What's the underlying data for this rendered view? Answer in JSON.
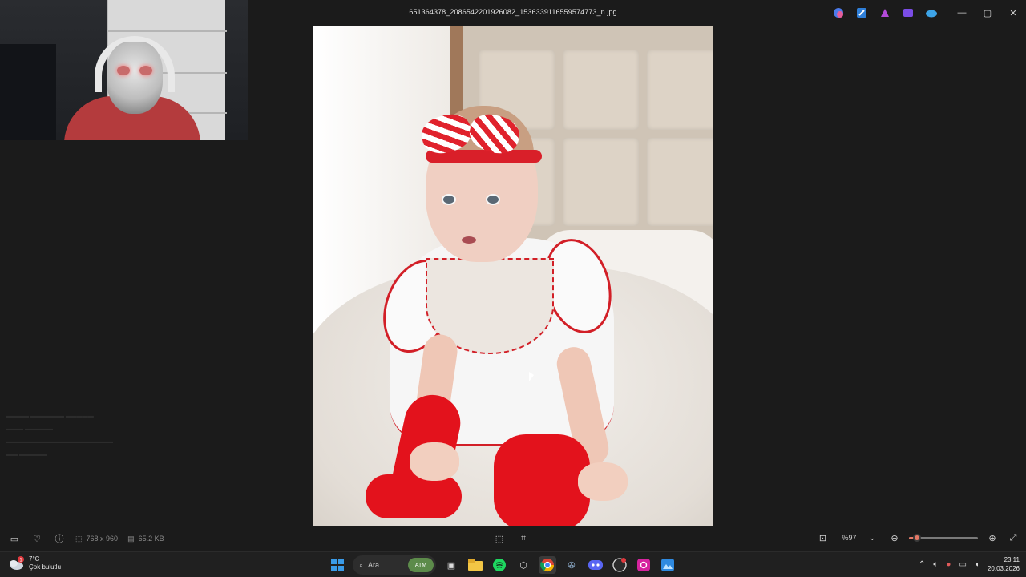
{
  "window": {
    "title": "651364378_2086542201926082_1536339116559574773_n.jpg",
    "controls": {
      "minimize": "—",
      "maximize": "▢",
      "close": "✕"
    }
  },
  "title_apps": [
    "copilot-icon",
    "photos-edit-icon",
    "designer-icon",
    "clipchamp-icon",
    "onedrive-icon"
  ],
  "image_info": {
    "dimensions": "768 x 960",
    "file_size": "65.2 KB"
  },
  "bottom_toolbar": {
    "zoom_value": "%97",
    "zoom_level": 0.12
  },
  "taskbar": {
    "weather": {
      "temp": "7°C",
      "condition": "Çok bulutlu",
      "badge": "1"
    },
    "search_placeholder": "Ara",
    "search_badge": "ATM",
    "clock": {
      "time": "23:11",
      "date": "20.03.2026"
    }
  },
  "colors": {
    "accent": "#e57866",
    "background": "#1b1b1b",
    "taskbar": "#202020"
  }
}
